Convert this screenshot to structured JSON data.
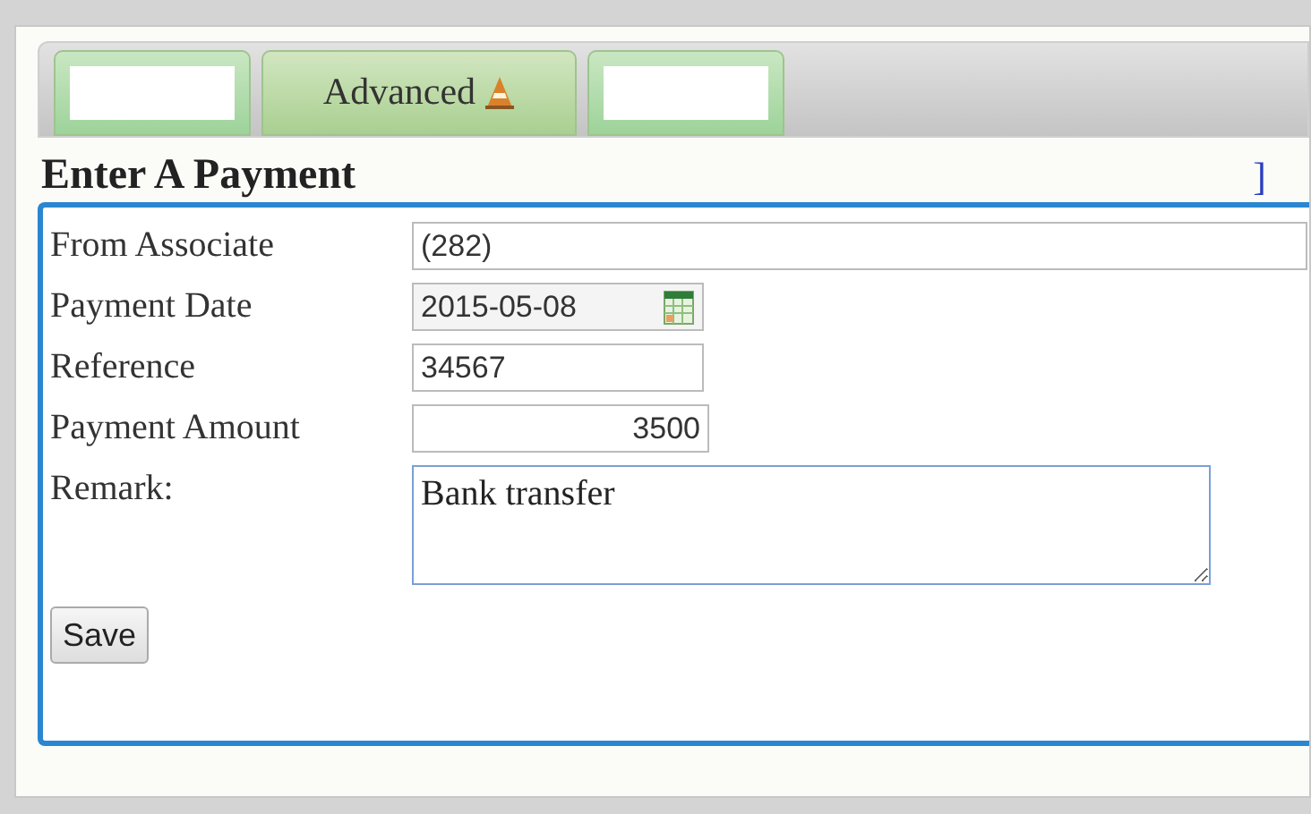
{
  "tabs": [
    {
      "selected": false
    },
    {
      "label": "Advanced",
      "selected": true,
      "warning": true
    },
    {
      "selected": false
    }
  ],
  "heading": "Enter A Payment",
  "header_link": "]",
  "fields": [
    {
      "kind": "wide_text",
      "label": "From Associate",
      "value": "(282)"
    },
    {
      "kind": "date",
      "label": "Payment Date",
      "value": "2015-05-08"
    },
    {
      "kind": "text",
      "label": "Reference",
      "value": "34567"
    },
    {
      "kind": "number",
      "label": "Payment Amount",
      "value": "3500"
    },
    {
      "kind": "textarea",
      "label": "Remark:",
      "value": "Bank transfer"
    }
  ],
  "save_button": "Save"
}
